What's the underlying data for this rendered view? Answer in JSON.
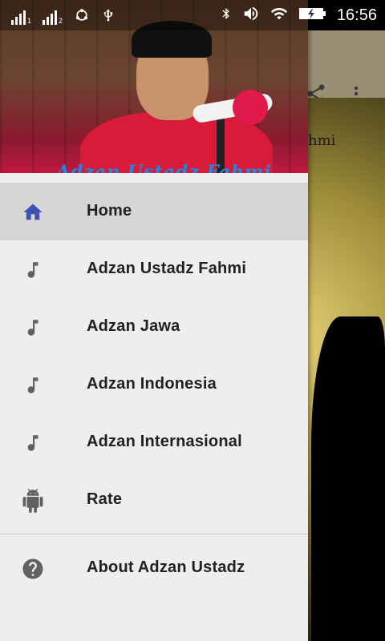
{
  "status_bar": {
    "time": "16:56",
    "sim1_label": "1",
    "sim2_label": "2"
  },
  "background": {
    "partial_text": "hmi"
  },
  "drawer": {
    "header_title": "Adzan Ustadz Fahmi",
    "items": [
      {
        "label": "Home",
        "icon": "home-icon",
        "active": true
      },
      {
        "label": "Adzan Ustadz Fahmi",
        "icon": "music-note-icon"
      },
      {
        "label": "Adzan Jawa",
        "icon": "music-note-icon"
      },
      {
        "label": "Adzan Indonesia",
        "icon": "music-note-icon"
      },
      {
        "label": "Adzan Internasional",
        "icon": "music-note-icon"
      },
      {
        "label": "Rate",
        "icon": "android-icon"
      }
    ],
    "footer_items": [
      {
        "label": "About Adzan Ustadz",
        "icon": "help-icon"
      }
    ]
  },
  "colors": {
    "active_icon": "#3f51b5",
    "inactive_icon": "#616161",
    "drawer_bg": "#eeeeee",
    "active_row": "#d6d6d6"
  }
}
